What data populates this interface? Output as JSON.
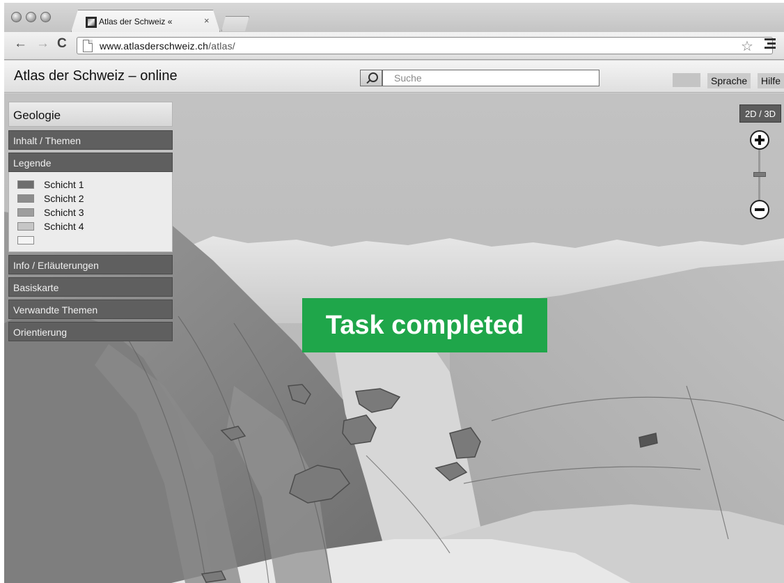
{
  "browser": {
    "tab": {
      "title": "Atlas der Schweiz «",
      "close": "×",
      "favicon": "atlas-favicon"
    },
    "nav": {
      "back": "←",
      "forward": "→",
      "reload": "C"
    },
    "url": {
      "host": "www.atlasderschweiz.ch",
      "path": "/atlas/"
    },
    "star": "☆"
  },
  "site": {
    "title": "Atlas der Schweiz – online",
    "search": {
      "placeholder": "Suche"
    },
    "buttons": {
      "language": "Sprache",
      "help": "Hilfe"
    }
  },
  "panel": {
    "title": "Geologie",
    "sections": {
      "content": "Inhalt / Themen",
      "legend": "Legende",
      "info": "Info / Erläuterungen",
      "basemap": "Basiskarte",
      "related": "Verwandte Themen",
      "orientation": "Orientierung"
    },
    "legend_items": [
      {
        "label": "Schicht 1",
        "color": "#6e6e6e"
      },
      {
        "label": "Schicht 2",
        "color": "#8c8c8c"
      },
      {
        "label": "Schicht 3",
        "color": "#9e9e9e"
      },
      {
        "label": "Schicht 4",
        "color": "#c6c6c6"
      },
      {
        "label": "",
        "color": "#f4f4f4"
      }
    ]
  },
  "map_controls": {
    "toggle": "2D / 3D",
    "zoom_in": "+",
    "zoom_out": "−"
  },
  "overlay": {
    "status": "Task completed",
    "color": "#1fa64a"
  }
}
